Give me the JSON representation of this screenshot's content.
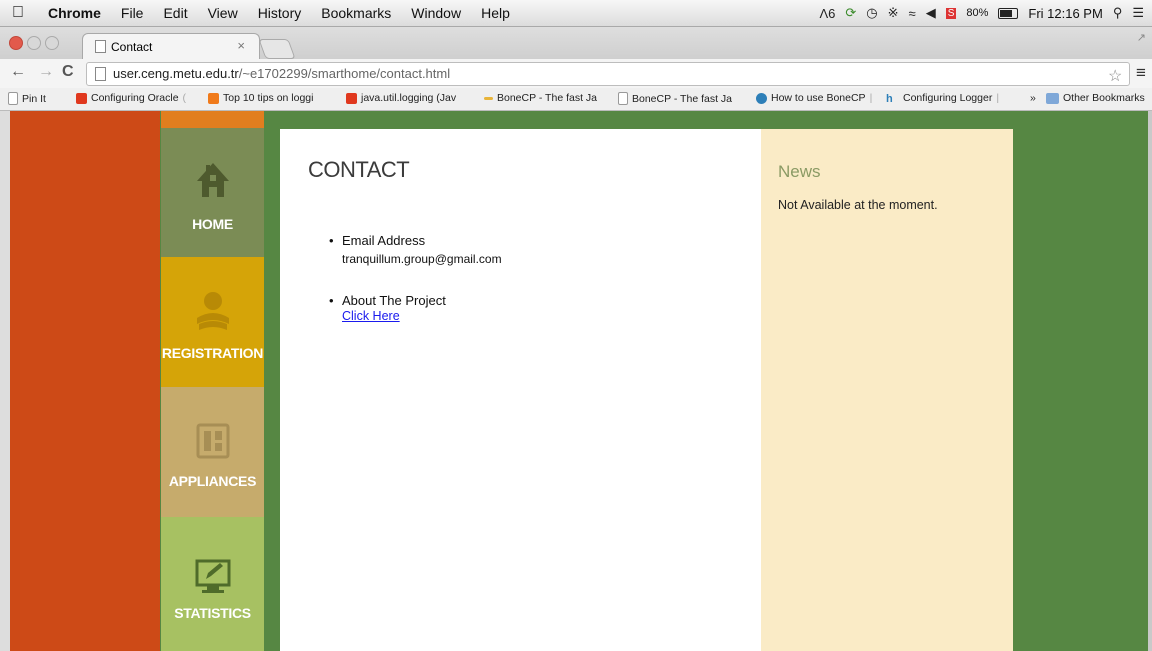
{
  "menubar": {
    "app": "Chrome",
    "items": [
      "File",
      "Edit",
      "View",
      "History",
      "Bookmarks",
      "Window",
      "Help"
    ],
    "adobe_count": "6",
    "battery": "80%",
    "clock": "Fri 12:16 PM"
  },
  "tab": {
    "title": "Contact",
    "close": "×"
  },
  "toolbar": {
    "back": "←",
    "forward": "→",
    "reload": "C",
    "url_host": "user.ceng.metu.edu.tr",
    "url_path": "/~e1702299/smarthome/contact.html"
  },
  "bookmarks": {
    "items": [
      {
        "label": "Pin It",
        "faded": "",
        "color": "#cccccc"
      },
      {
        "label": "Configuring Oracle",
        "faded": " (",
        "color": "#e0381e"
      },
      {
        "label": "Top 10 tips on loggi",
        "faded": "",
        "color": "#f07a1a"
      },
      {
        "label": "java.util.logging (Jav",
        "faded": "",
        "color": "#e0381e"
      },
      {
        "label": "BoneCP - The fast Ja",
        "faded": "",
        "color": "#e8b43a"
      },
      {
        "label": "BoneCP - The fast Ja",
        "faded": "",
        "color": "#cccccc"
      },
      {
        "label": "How to use BoneCP",
        "faded": " |",
        "color": "#2d7fb8"
      },
      {
        "label": "Configuring Logger",
        "faded": " |",
        "color": "#2d7fb8"
      }
    ],
    "overflow": "»",
    "other": "Other Bookmarks"
  },
  "nav": {
    "home": "HOME",
    "registration": "REGISTRATION",
    "appliances": "APPLIANCES",
    "statistics": "STATISTICS"
  },
  "content": {
    "title": "CONTACT",
    "email_heading": "Email Address",
    "email_value": "tranquillum.group@gmail.com",
    "project_heading": "About The Project",
    "project_link": "Click Here"
  },
  "news": {
    "title": "News",
    "text": "Not Available at the moment."
  },
  "colors": {
    "background_green": "#568743",
    "red_bar": "#cd4a17",
    "home_tile": "#7b8c55",
    "registration_tile": "#d5a408",
    "appliances_tile": "#c6ab6c",
    "statistics_tile": "#a7c162",
    "news_panel": "#faebc6",
    "link": "#1a1aee"
  }
}
